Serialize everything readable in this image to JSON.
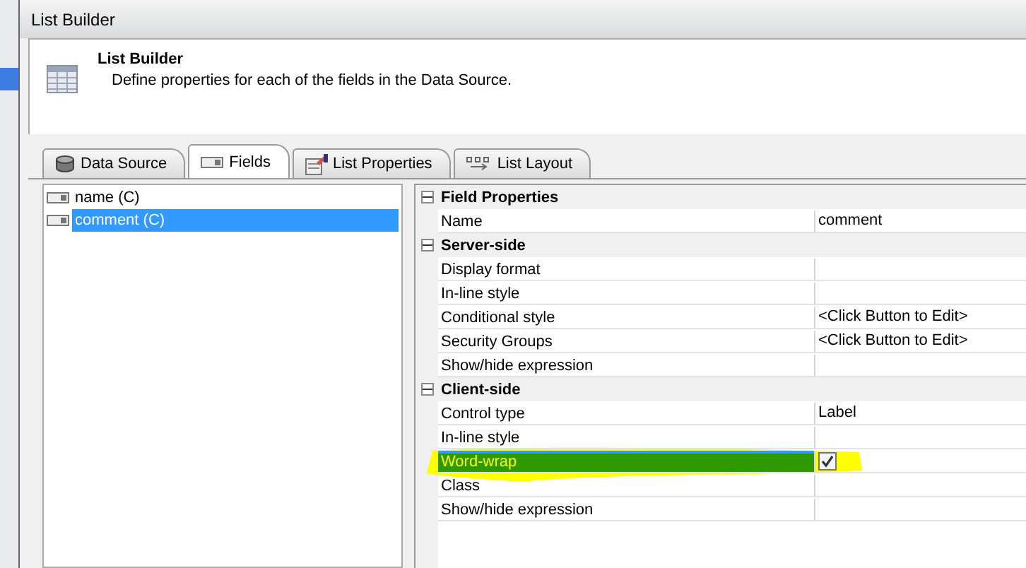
{
  "window": {
    "title": "List Builder"
  },
  "header": {
    "title": "List Builder",
    "description": "Define properties for each of the fields in the Data Source."
  },
  "tabs": [
    {
      "label": "Data Source",
      "kind": "database",
      "selected": false
    },
    {
      "label": "Fields",
      "kind": "field",
      "selected": true
    },
    {
      "label": "List Properties",
      "kind": "form",
      "selected": false
    },
    {
      "label": "List Layout",
      "kind": "layout",
      "selected": false
    }
  ],
  "fields": [
    {
      "label": "name (C)",
      "selected": false
    },
    {
      "label": "comment (C)",
      "selected": true
    }
  ],
  "property_grid": {
    "categories": [
      {
        "title": "Field Properties",
        "expanded": true,
        "properties": [
          {
            "name": "Name",
            "kind": "text",
            "value": "comment",
            "selected": false,
            "highlighted": false
          }
        ]
      },
      {
        "title": "Server-side",
        "expanded": true,
        "properties": [
          {
            "name": "Display format",
            "kind": "text",
            "selected": false,
            "highlighted": false
          },
          {
            "name": "In-line style",
            "kind": "text",
            "selected": false,
            "highlighted": false
          },
          {
            "name": "Conditional style",
            "kind": "text",
            "value": "<Click Button to Edit>",
            "selected": false,
            "highlighted": false
          },
          {
            "name": "Security Groups",
            "kind": "text",
            "value": "<Click Button to Edit>",
            "selected": false,
            "highlighted": false
          },
          {
            "name": "Show/hide expression",
            "kind": "text",
            "selected": false,
            "highlighted": false
          }
        ]
      },
      {
        "title": "Client-side",
        "expanded": true,
        "properties": [
          {
            "name": "Control type",
            "kind": "text",
            "value": "Label",
            "selected": false,
            "highlighted": false
          },
          {
            "name": "In-line style",
            "kind": "text",
            "selected": false,
            "highlighted": false
          },
          {
            "name": "Word-wrap",
            "kind": "checkbox",
            "checked": true,
            "selected": true,
            "highlighted": true
          },
          {
            "name": "Class",
            "kind": "text",
            "selected": false,
            "highlighted": false
          },
          {
            "name": "Show/hide expression",
            "kind": "text",
            "selected": false,
            "highlighted": false
          }
        ]
      }
    ]
  }
}
